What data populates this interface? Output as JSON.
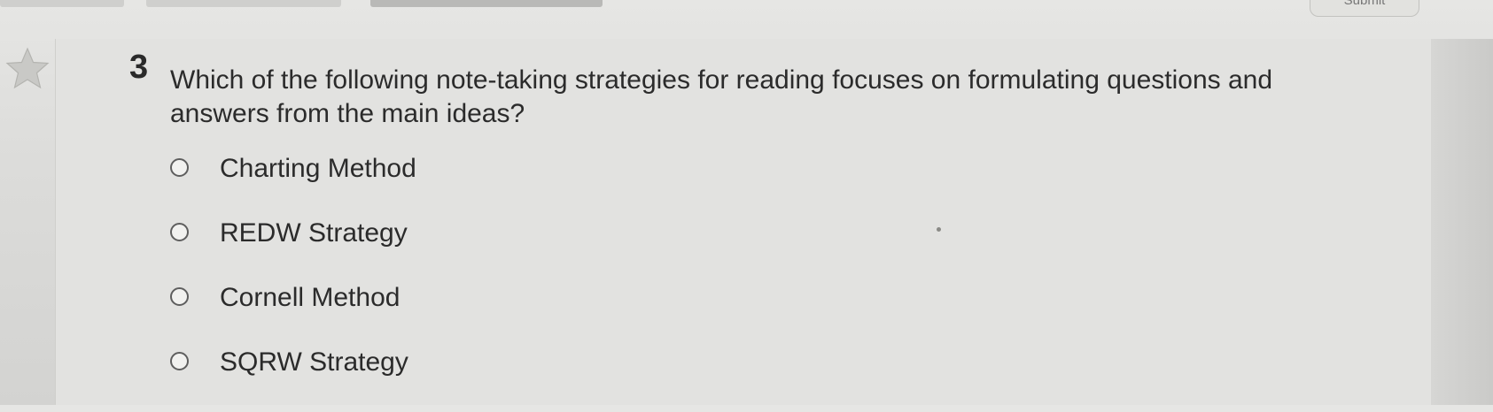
{
  "header": {
    "submit_label": "Submit"
  },
  "question": {
    "number": "3",
    "text": "Which of the following note-taking strategies for reading focuses on formulating questions and answers from the main ideas?",
    "options": [
      {
        "label": "Charting Method",
        "selected": false
      },
      {
        "label": "REDW Strategy",
        "selected": false
      },
      {
        "label": "Cornell Method",
        "selected": false
      },
      {
        "label": "SQRW Strategy",
        "selected": false
      }
    ]
  },
  "icons": {
    "bookmark": "star-icon",
    "option_marker": "radio-button"
  },
  "colors": {
    "background": "#dcdcda",
    "panel": "#e2e2e0",
    "text": "#2b2b2b",
    "radio_border": "#5e5e5e"
  }
}
